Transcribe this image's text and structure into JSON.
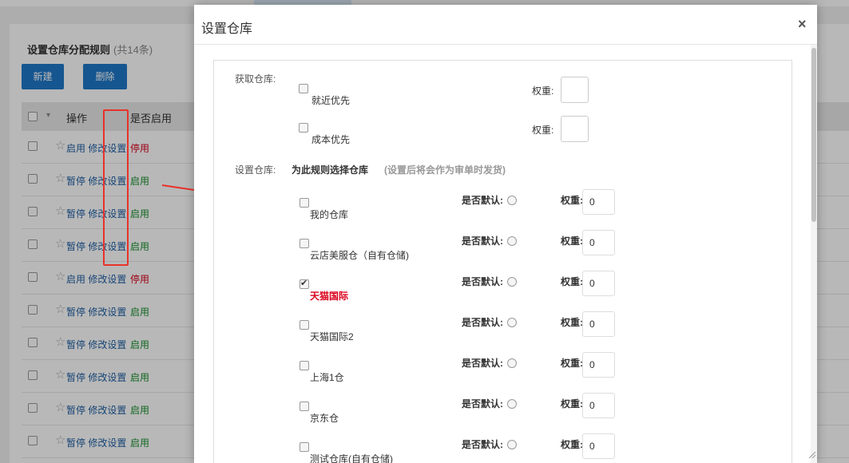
{
  "background": {
    "title": "设置仓库分配规则",
    "count": "(共14条)",
    "buttons": {
      "new": "新建",
      "delete": "删除"
    },
    "columns": {
      "action": "操作",
      "enabled": "是否启用"
    },
    "rows": [
      {
        "toggle": "启用",
        "edit": "修改设置",
        "status": "停用",
        "status_color": "red"
      },
      {
        "toggle": "暂停",
        "edit": "修改设置",
        "status": "启用",
        "status_color": "green"
      },
      {
        "toggle": "暂停",
        "edit": "修改设置",
        "status": "启用",
        "status_color": "green"
      },
      {
        "toggle": "暂停",
        "edit": "修改设置",
        "status": "启用",
        "status_color": "green"
      },
      {
        "toggle": "启用",
        "edit": "修改设置",
        "status": "停用",
        "status_color": "red"
      },
      {
        "toggle": "暂停",
        "edit": "修改设置",
        "status": "启用",
        "status_color": "green"
      },
      {
        "toggle": "暂停",
        "edit": "修改设置",
        "status": "启用",
        "status_color": "green"
      },
      {
        "toggle": "暂停",
        "edit": "修改设置",
        "status": "启用",
        "status_color": "green"
      },
      {
        "toggle": "暂停",
        "edit": "修改设置",
        "status": "启用",
        "status_color": "green"
      },
      {
        "toggle": "暂停",
        "edit": "修改设置",
        "status": "启用",
        "status_color": "green"
      }
    ]
  },
  "modal": {
    "title": "设置仓库",
    "close": "×",
    "fetch_label": "获取仓库:",
    "fetch_options": [
      {
        "name": "就近优先",
        "weight_label": "权重:"
      },
      {
        "name": "成本优先",
        "weight_label": "权重:"
      }
    ],
    "set_label": "设置仓库:",
    "set_heading": "为此规则选择仓库",
    "set_hint": "(设置后将会作为审单时发货)",
    "default_label": "是否默认:",
    "weight_label": "权重:",
    "warehouses": [
      {
        "name": "我的仓库",
        "checked": false,
        "weight": "0"
      },
      {
        "name": "云店美服仓（自有仓储)",
        "checked": false,
        "weight": "0"
      },
      {
        "name": "天猫国际",
        "checked": true,
        "weight": "0"
      },
      {
        "name": "天猫国际2",
        "checked": false,
        "weight": "0"
      },
      {
        "name": "上海1仓",
        "checked": false,
        "weight": "0"
      },
      {
        "name": "京东仓",
        "checked": false,
        "weight": "0"
      },
      {
        "name": "测试仓库(自有仓储)",
        "checked": false,
        "weight": "0"
      }
    ]
  },
  "colors": {
    "accent": "#1f78c8",
    "annotation": "#e8322b",
    "danger": "#d9001b",
    "success": "#1a8f2e"
  }
}
